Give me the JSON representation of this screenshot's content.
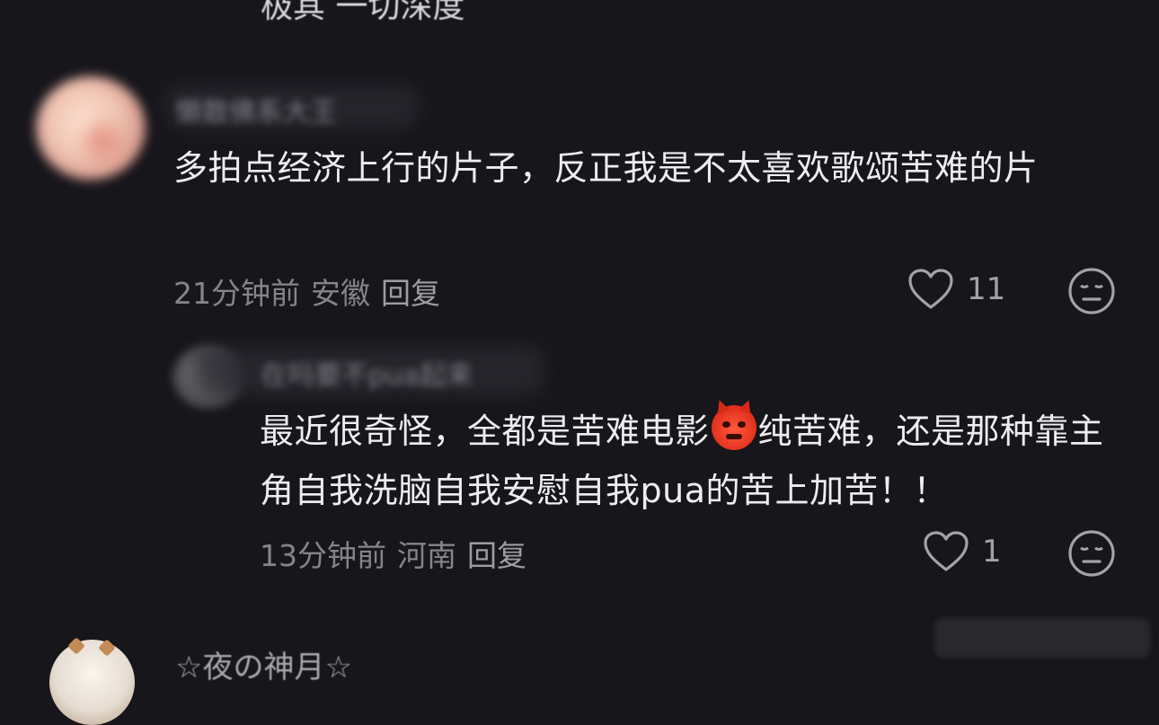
{
  "top": {
    "cut_text": "极其 一切深度"
  },
  "comments": [
    {
      "username": "懒散佛系大王",
      "text": "多拍点经济上行的片子，反正我是不太喜欢歌颂苦难的片",
      "time": "21分钟前",
      "location": "安徽",
      "reply_label": "回复",
      "likes": "11"
    },
    {
      "username": "在吗要不pua起来",
      "text_before_emoji": "最近很奇怪，全都是苦难电影",
      "text_after_emoji": "纯苦难，还是那种靠主角自我洗脑自我安慰自我pua的苦上加苦！！",
      "emoji": "angry-devil-emoji",
      "time": "13分钟前",
      "location": "河南",
      "reply_label": "回复",
      "likes": "1"
    }
  ],
  "next_comment": {
    "username": "☆夜の神月☆"
  },
  "icons": {
    "like": "heart-outline-icon",
    "dislike": "meh-face-icon"
  },
  "colors": {
    "background": "#17161b",
    "text": "#ededf0",
    "meta": "#85848b"
  }
}
